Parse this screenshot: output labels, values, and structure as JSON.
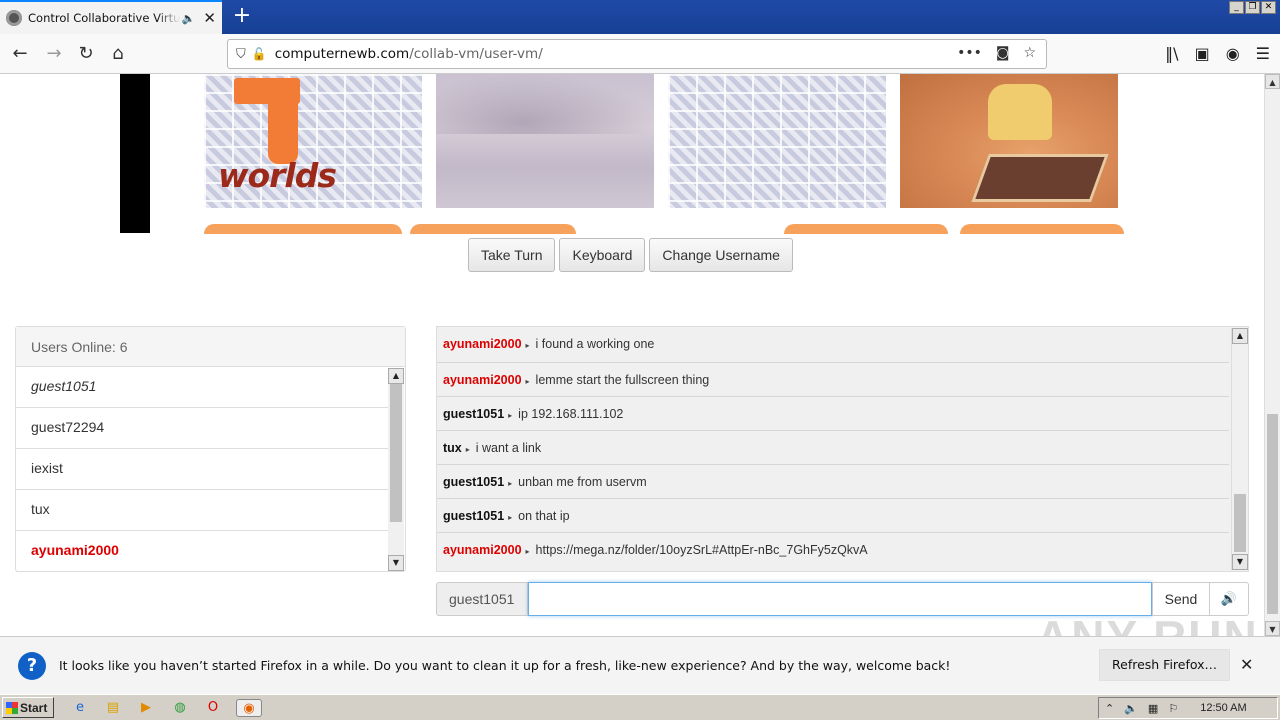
{
  "browser": {
    "tab_title": "Control Collaborative Virtual Machines",
    "url_host": "computernewb.com",
    "url_path": "/collab-vm/user-vm/"
  },
  "vm_thumbs": [
    {
      "logo_text": "worlds"
    },
    {},
    {},
    {}
  ],
  "actions": {
    "take_turn": "Take Turn",
    "keyboard": "Keyboard",
    "change_username": "Change Username"
  },
  "users": {
    "header": "Users Online: 6",
    "list": [
      {
        "name": "guest1051"
      },
      {
        "name": "guest72294"
      },
      {
        "name": "iexist"
      },
      {
        "name": "tux"
      },
      {
        "name": "ayunami2000"
      }
    ]
  },
  "chat": {
    "messages": [
      {
        "user": "ayunami2000",
        "text": "i found a working one"
      },
      {
        "user": "ayunami2000",
        "text": "lemme start the fullscreen thing"
      },
      {
        "user": "guest1051",
        "text": "ip 192.168.111.102"
      },
      {
        "user": "tux",
        "text": "i want a link"
      },
      {
        "user": "guest1051",
        "text": "unban me from uservm"
      },
      {
        "user": "guest1051",
        "text": "on that ip"
      },
      {
        "user": "ayunami2000",
        "text": "https://mega.nz/folder/10oyzSrL#AttpEr-nBc_7GhFy5zQkvA"
      }
    ],
    "username": "guest1051",
    "input_value": "",
    "send_label": "Send"
  },
  "notification": {
    "message": "It looks like you haven’t started Firefox in a while. Do you want to clean it up for a fresh, like-new experience? And by the way, welcome back!",
    "refresh_label": "Refresh Firefox…"
  },
  "taskbar": {
    "start_label": "Start",
    "clock": "12:50 AM"
  },
  "watermark": "ANY RUN",
  "colors": {
    "admin_red": "#dd0000",
    "accent_blue": "#0a84ff"
  }
}
